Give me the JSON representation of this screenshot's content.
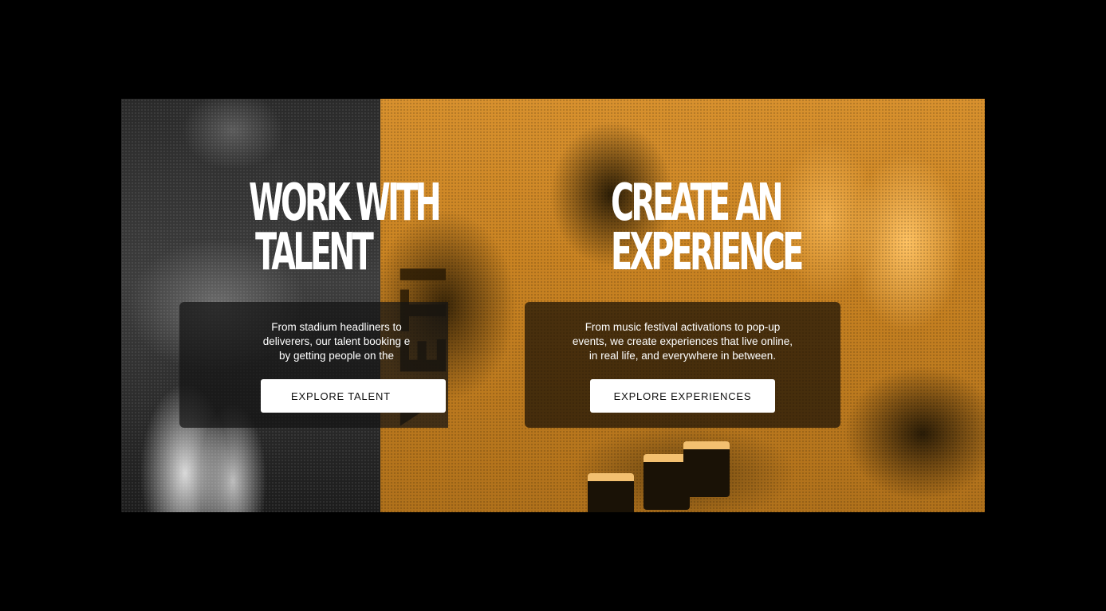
{
  "panels": {
    "talent": {
      "heading_line1": "WORK WITH",
      "heading_line2": "TALENT",
      "description": "From stadium headliners to deliverers, our talent booking experts deliver by getting people on the",
      "desc_line1": "From stadium headliners to",
      "desc_line2": "deliverers, our talent booking e",
      "desc_line3": "by getting people on the",
      "button_label": "EXPLORE TALENT",
      "tint": "#8c8c8c"
    },
    "experience": {
      "heading_line1": "CREATE AN",
      "heading_line2": "EXPERIENCE",
      "desc_line1": "From music festival activations to pop-up",
      "desc_line2": "events, we create experiences that live online,",
      "desc_line3": "in real life, and everywhere in between.",
      "button_label": "EXPLORE EXPERIENCES",
      "tint": "#e8a33d",
      "photo_brand_text": "YETI"
    }
  },
  "colors": {
    "page_background": "#000000",
    "orange_tint": "#e8a33d",
    "button_background": "#ffffff",
    "button_text": "#111111"
  }
}
